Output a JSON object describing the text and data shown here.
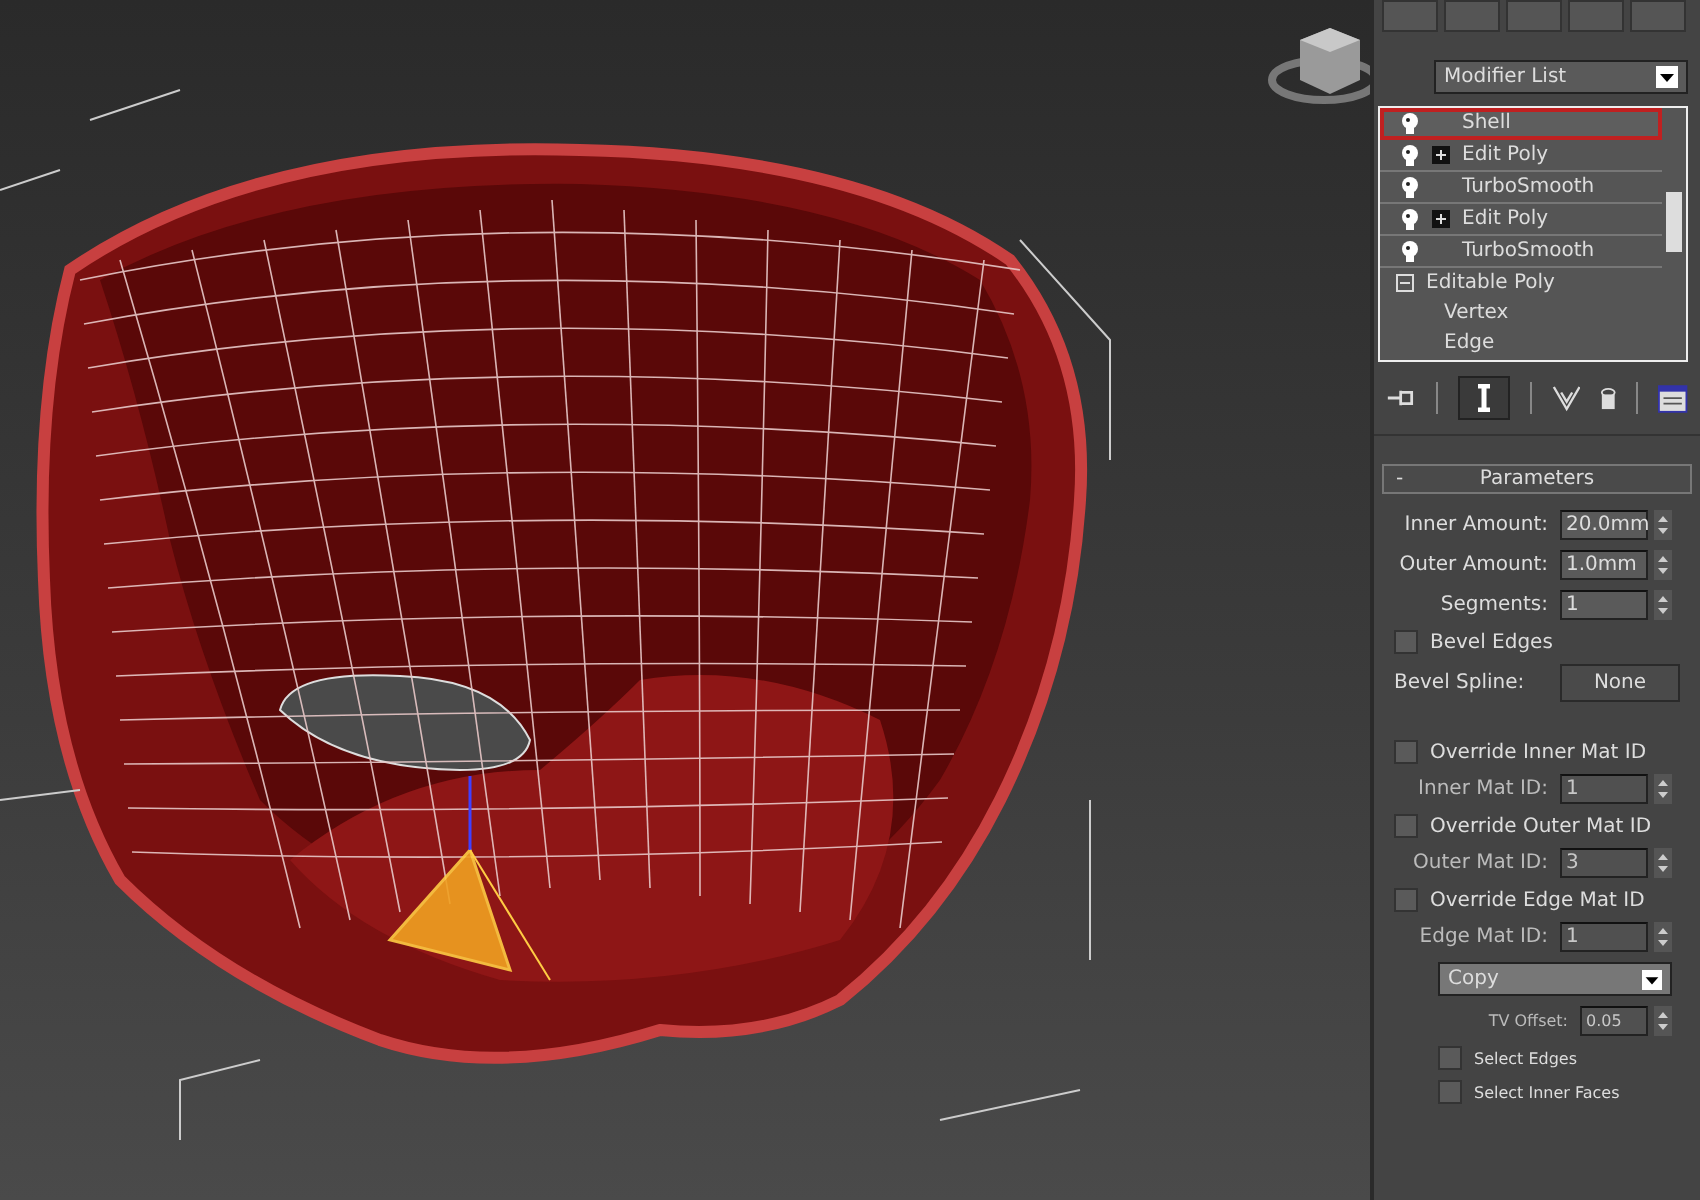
{
  "command_panel": {
    "modifier_list": {
      "value": "Modifier List"
    },
    "stack": [
      {
        "label": "Shell",
        "kind": "modifier",
        "selected": true,
        "has_plus": false
      },
      {
        "label": "Edit Poly",
        "kind": "modifier",
        "selected": false,
        "has_plus": true
      },
      {
        "label": "TurboSmooth",
        "kind": "modifier",
        "selected": false,
        "has_plus": false
      },
      {
        "label": "Edit Poly",
        "kind": "modifier",
        "selected": false,
        "has_plus": true
      },
      {
        "label": "TurboSmooth",
        "kind": "modifier",
        "selected": false,
        "has_plus": false
      },
      {
        "label": "Editable Poly",
        "kind": "base",
        "selected": false,
        "expanded": true,
        "children": [
          {
            "label": "Vertex",
            "selected": false
          },
          {
            "label": "Edge",
            "selected": false
          }
        ]
      }
    ],
    "rollout": {
      "title": "Parameters",
      "toggle": "-",
      "expanded": true,
      "controls": [
        {
          "kind": "spinner",
          "label": "Inner Amount:",
          "value": "20.0mm",
          "disabled": false
        },
        {
          "kind": "spinner",
          "label": "Outer Amount:",
          "value": "1.0mm",
          "disabled": false
        },
        {
          "kind": "spinner",
          "label": "Segments:",
          "value": "1",
          "disabled": false
        },
        {
          "kind": "checkbox",
          "label": "Bevel Edges",
          "checked": false
        },
        {
          "kind": "button",
          "label": "Bevel Spline:",
          "value": "None"
        },
        {
          "kind": "checkbox",
          "label": "Override Inner Mat ID",
          "checked": false
        },
        {
          "kind": "spinner",
          "label": "Inner Mat ID:",
          "value": "1",
          "disabled": true
        },
        {
          "kind": "checkbox",
          "label": "Override Outer Mat ID",
          "checked": false
        },
        {
          "kind": "spinner",
          "label": "Outer Mat ID:",
          "value": "3",
          "disabled": true
        },
        {
          "kind": "checkbox",
          "label": "Override Edge Mat ID",
          "checked": false
        },
        {
          "kind": "spinner",
          "label": "Edge Mat ID:",
          "value": "1",
          "disabled": true
        },
        {
          "kind": "dropdown",
          "value": "Copy"
        },
        {
          "kind": "spinner",
          "label": "TV Offset:",
          "value": "0.05",
          "disabled": true
        },
        {
          "kind": "checkbox",
          "label": "Select Edges",
          "checked": false
        },
        {
          "kind": "checkbox",
          "label": "Select Inner Faces",
          "checked": false
        }
      ]
    }
  }
}
